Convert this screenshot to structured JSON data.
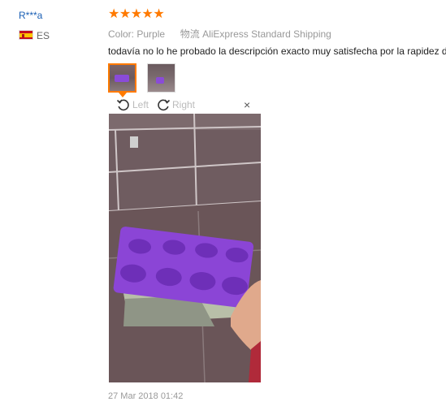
{
  "reviewer": {
    "name": "R***a",
    "country": "ES",
    "flag_icon": "spain-flag-icon"
  },
  "rating": {
    "stars": 5,
    "display": "★★★★★",
    "color": "#ff7a00"
  },
  "meta": {
    "color_label": "Color:",
    "color_value": "Purple",
    "shipping_label": "物流",
    "shipping_value": "AliExpress Standard Shipping"
  },
  "review_text": "todavía no lo he probado la descripción exacto muy satisfecha por la rapidez d",
  "thumbnails": [
    {
      "name": "review-photo-1",
      "selected": true
    },
    {
      "name": "review-photo-2",
      "selected": false
    }
  ],
  "viewer": {
    "rotate_left_label": "Left",
    "rotate_right_label": "Right",
    "close_symbol": "×"
  },
  "date": "27 Mar 2018 01:42"
}
